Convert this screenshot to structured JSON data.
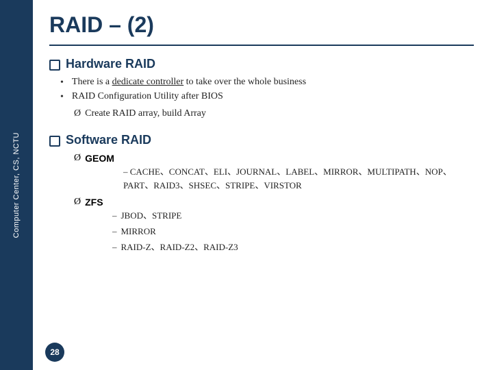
{
  "sidebar": {
    "text": "Computer Center, CS, NCTU"
  },
  "header": {
    "title": "RAID – (2)"
  },
  "sections": [
    {
      "id": "hardware-raid",
      "heading": "Hardware RAID",
      "bullets": [
        {
          "text_prefix": "There is a ",
          "text_underline": "dedicate controller",
          "text_suffix": " to take over the whole business"
        },
        {
          "text": "RAID Configuration Utility after BIOS"
        }
      ],
      "sub_items": [
        {
          "arrow": "Ø",
          "text": "Create RAID array, build Array"
        }
      ]
    },
    {
      "id": "software-raid",
      "heading": "Software RAID",
      "geom": {
        "label": "GEOM",
        "items": "CACHE、CONCAT、ELI、JOURNAL、LABEL、MIRROR、MULTIPATH、NOP、PART、RAID3、SHSEC、STRIPE、VIRSTOR"
      },
      "zfs": {
        "label": "ZFS",
        "items": [
          "JBOD、STRIPE",
          "MIRROR",
          "RAID-Z、RAID-Z2、RAID-Z3"
        ]
      }
    }
  ],
  "page_number": "28"
}
